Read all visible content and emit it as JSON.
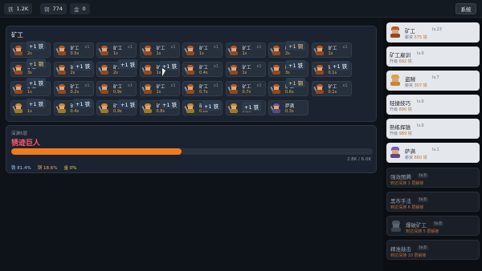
{
  "resources": [
    {
      "key": "铁",
      "value": "1.2K"
    },
    {
      "key": "铜",
      "value": "774"
    },
    {
      "key": "金",
      "value": "0"
    }
  ],
  "system_label": "系统",
  "miners": {
    "title": "矿工",
    "cells": [
      {
        "name": "矿工",
        "count": "x1",
        "rate": "2s"
      },
      {
        "name": "矿工",
        "count": "x1",
        "rate": "0.5s"
      },
      {
        "name": "矿工",
        "count": "x1",
        "rate": "1s"
      },
      {
        "name": "矿工",
        "count": "x1",
        "rate": "1s"
      },
      {
        "name": "矿工",
        "count": "x1",
        "rate": "1s"
      },
      {
        "name": "矿工",
        "count": "x1",
        "rate": "1s"
      },
      {
        "name": "矿工",
        "count": "x1",
        "rate": "2s"
      },
      {
        "name": "矿工",
        "count": "x1",
        "rate": "1s"
      },
      {
        "name": "矿工",
        "count": "x1",
        "rate": "3s"
      },
      {
        "name": "矿工",
        "count": "x1",
        "rate": "2s"
      },
      {
        "name": "矿工",
        "count": "x1",
        "rate": "2s"
      },
      {
        "name": "矿工",
        "count": "x1",
        "rate": "1s"
      },
      {
        "name": "矿工",
        "count": "x1",
        "rate": "0.4s"
      },
      {
        "name": "矿工",
        "count": "x1",
        "rate": "1s"
      },
      {
        "name": "矿工",
        "count": "x1",
        "rate": "3s"
      },
      {
        "name": "矿工",
        "count": "x1",
        "rate": "0.1s"
      },
      {
        "name": "矿工",
        "count": "x1",
        "rate": "1s"
      },
      {
        "name": "矿工",
        "count": "x1",
        "rate": "0.2s"
      },
      {
        "name": "矿工",
        "count": "x1",
        "rate": "0.9s"
      },
      {
        "name": "矿工",
        "count": "x1",
        "rate": "1s"
      },
      {
        "name": "矿工",
        "count": "x1",
        "rate": "0.7s"
      },
      {
        "name": "矿工",
        "count": "x1",
        "rate": "0.7s"
      },
      {
        "name": "矿工",
        "count": "x1",
        "rate": "0.6s"
      },
      {
        "name": "矿工",
        "count": "x1",
        "rate": "0.1s"
      },
      {
        "name": "矿工",
        "count": "x1",
        "rate": "1s"
      },
      {
        "name": "矿工",
        "count": "x1",
        "rate": "0.4s"
      },
      {
        "name": "矿工",
        "count": "x1",
        "rate": "0.9s"
      },
      {
        "name": "矿工",
        "count": "x1",
        "rate": "0.8s"
      },
      {
        "name": "矿工",
        "count": "x1",
        "rate": "0.8s"
      },
      {
        "name": "矿工",
        "count": "x1",
        "rate": "0.8s"
      },
      {
        "name": "萨满",
        "count": "",
        "rate": "0.3s"
      }
    ],
    "floats": [
      {
        "text": "+1 铁"
      },
      {
        "text": "+1 铜"
      },
      {
        "text": "+1 铜"
      },
      {
        "text": "+1 铁"
      },
      {
        "text": "+1 铁"
      },
      {
        "text": "+1 铁"
      },
      {
        "text": "+1 铁"
      },
      {
        "text": "+1 铁"
      },
      {
        "text": "+1 铁"
      },
      {
        "text": "+1 铜"
      },
      {
        "text": "+1 铁"
      },
      {
        "text": "+1 铁"
      },
      {
        "text": "+1 铁"
      },
      {
        "text": "+1 铁"
      },
      {
        "text": "+1 铁"
      },
      {
        "text": "+1 铁"
      }
    ]
  },
  "depth": {
    "label": "深渊5层",
    "boss": "锈迹巨人",
    "hp_fraction": 0.47,
    "hp_text": "2.8K / 6.0K",
    "odds": [
      {
        "label": "铁 81.4%"
      },
      {
        "label": "铜 18.6%"
      },
      {
        "label": "金 0%"
      }
    ]
  },
  "shop": [
    {
      "title": "矿工",
      "level": "lv.23",
      "sub": "薪资",
      "price": "575 铁"
    },
    {
      "title": "矿工雇训",
      "level": "lv.0",
      "sub": "升级",
      "price": "692 铁"
    },
    {
      "title": "盗贼",
      "level": "lv.7",
      "sub": "薪资",
      "price": "307 铁"
    },
    {
      "title": "轻捷技巧",
      "level": "lv.0",
      "sub": "升级",
      "price": "890 铁"
    },
    {
      "title": "熟练挥镐",
      "level": "lv.0",
      "sub": "升级",
      "price": "989 铁"
    },
    {
      "title": "萨满",
      "level": "lv.1",
      "sub": "薪资",
      "price": "660 铁"
    },
    {
      "title": "强效图腾",
      "level": "lv.0",
      "sub": "到达深渊 1 层解锁",
      "price": ""
    },
    {
      "title": "黑市手法",
      "level": "lv.0",
      "sub": "到达深渊 6 层解锁",
      "price": ""
    },
    {
      "title": "爆破矿工",
      "level": "lv.0",
      "sub": "到达深渊 5 层解锁",
      "price": ""
    },
    {
      "title": "精准敲击",
      "level": "lv.0",
      "sub": "到达深渊 10 层解锁",
      "price": ""
    }
  ]
}
